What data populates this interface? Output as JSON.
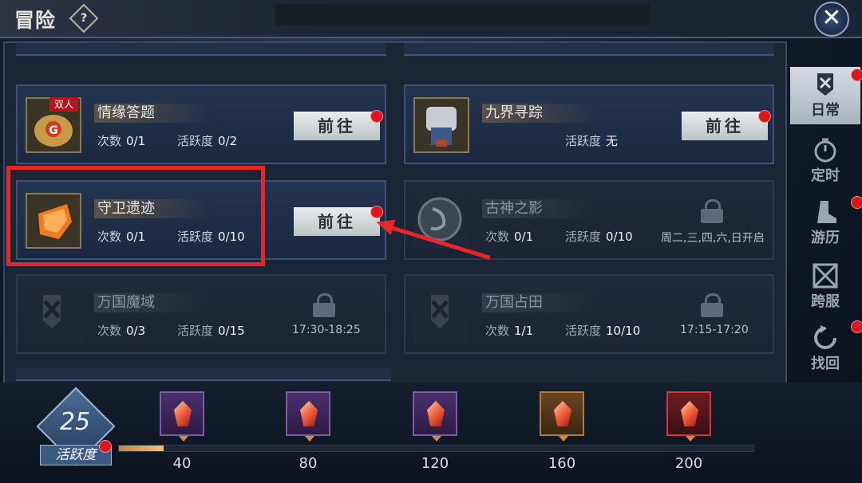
{
  "header": {
    "title": "冒险",
    "help_glyph": "?",
    "close_glyph": "✕"
  },
  "cards": [
    {
      "name": "情缘答题",
      "badge": "双人",
      "count_label": "次数",
      "count": "0/1",
      "activity_label": "活跃度",
      "activity": "0/2",
      "button": "前往",
      "locked": false,
      "icon": "bag-icon"
    },
    {
      "name": "九界寻踪",
      "activity_label": "活跃度",
      "activity": "无",
      "button": "前往",
      "locked": false,
      "icon": "armor-icon"
    },
    {
      "name": "守卫遗迹",
      "count_label": "次数",
      "count": "0/1",
      "activity_label": "活跃度",
      "activity": "0/10",
      "button": "前往",
      "locked": false,
      "icon": "orange-shield-icon"
    },
    {
      "name": "古神之影",
      "count_label": "次数",
      "count": "0/1",
      "activity_label": "活跃度",
      "activity": "0/10",
      "note": "周二,三,四,六,日开启",
      "locked": true,
      "icon": "shadow-orb-icon"
    },
    {
      "name": "万国魔域",
      "count_label": "次数",
      "count": "0/3",
      "activity_label": "活跃度",
      "activity": "0/15",
      "note": "17:30-18:25",
      "locked": true,
      "icon": "crossed-swords-banner-icon"
    },
    {
      "name": "万国占田",
      "count_label": "次数",
      "count": "1/1",
      "activity_label": "活跃度",
      "activity": "10/10",
      "note": "17:15-17:20",
      "locked": true,
      "icon": "crossed-swords-banner-icon"
    }
  ],
  "tabs": [
    {
      "label": "日常",
      "active": true,
      "dot": true
    },
    {
      "label": "定时",
      "active": false,
      "dot": false
    },
    {
      "label": "游历",
      "active": false,
      "dot": true
    },
    {
      "label": "跨服",
      "active": false,
      "dot": false
    },
    {
      "label": "找回",
      "active": false,
      "dot": true
    }
  ],
  "activity": {
    "current": "25",
    "label": "活跃度",
    "progress": 0.07,
    "milestones": [
      {
        "value": "40",
        "style": "purple"
      },
      {
        "value": "80",
        "style": "purple"
      },
      {
        "value": "120",
        "style": "purple"
      },
      {
        "value": "160",
        "style": "gold"
      },
      {
        "value": "200",
        "style": "red"
      }
    ]
  }
}
